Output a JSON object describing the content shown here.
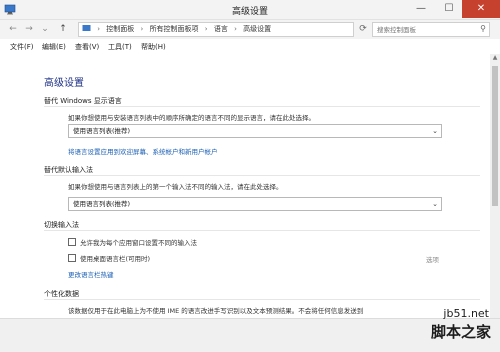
{
  "window": {
    "title": "高级设置",
    "minimize": "—",
    "maximize": "☐",
    "close": "✕"
  },
  "nav": {
    "back": "←",
    "forward": "→",
    "recent": "⌄",
    "up": "↑",
    "refresh": "⟳"
  },
  "breadcrumb": {
    "items": [
      "控制面板",
      "所有控制面板项",
      "语言",
      "高级设置"
    ],
    "separator": "›"
  },
  "search": {
    "placeholder": "搜索控制面板"
  },
  "menu": {
    "items": [
      "文件(F)",
      "编辑(E)",
      "查看(V)",
      "工具(T)",
      "帮助(H)"
    ]
  },
  "page": {
    "title": "高级设置",
    "display_language": {
      "heading": "替代 Windows 显示语言",
      "description": "如果你想使用与安装语言列表中的顺序所确定的语言不同的显示语言，请在此处选择。",
      "select_value": "使用语言列表(推荐)",
      "link": "将语言设置应用到欢迎屏幕、系统帐户和新用户帐户"
    },
    "default_input": {
      "heading": "替代默认输入法",
      "description": "如果你想使用与语言列表上的第一个输入法不同的输入法，请在此处选择。",
      "select_value": "使用语言列表(推荐)"
    },
    "switch_input": {
      "heading": "切换输入法",
      "option1": "允许我为每个应用窗口设置不同的输入法",
      "option2": "使用桌面语言栏(可用时)",
      "options_link": "选项",
      "hotkey_link": "更改语言栏热键"
    },
    "personalization": {
      "heading": "个性化数据",
      "description": "该数据仅用于在此电脑上为不使用 IME 的语言改进手写识别以及文本预测结果。不会将任何信息发送到"
    }
  },
  "watermark": {
    "url": "jb51.net",
    "name": "脚本之家"
  }
}
